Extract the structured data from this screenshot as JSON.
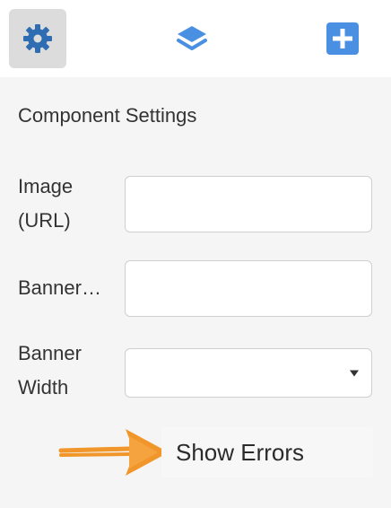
{
  "toolbar": {
    "items": [
      {
        "icon": "gear-icon",
        "active": true
      },
      {
        "icon": "layers-icon",
        "active": false
      },
      {
        "icon": "plus-square-icon",
        "active": false
      }
    ],
    "accent": "#4a90e2",
    "active_icon_color": "#2f6db3"
  },
  "panel": {
    "title": "Component Settings",
    "fields": [
      {
        "label_line1": "Image",
        "label_line2": "(URL)",
        "type": "text",
        "value": ""
      },
      {
        "label": "Banner…",
        "type": "text",
        "value": ""
      },
      {
        "label_line1": "Banner",
        "label_line2": "Width",
        "type": "select",
        "value": ""
      }
    ],
    "show_errors_label": "Show Errors",
    "annotation_color": "#f0962a"
  }
}
